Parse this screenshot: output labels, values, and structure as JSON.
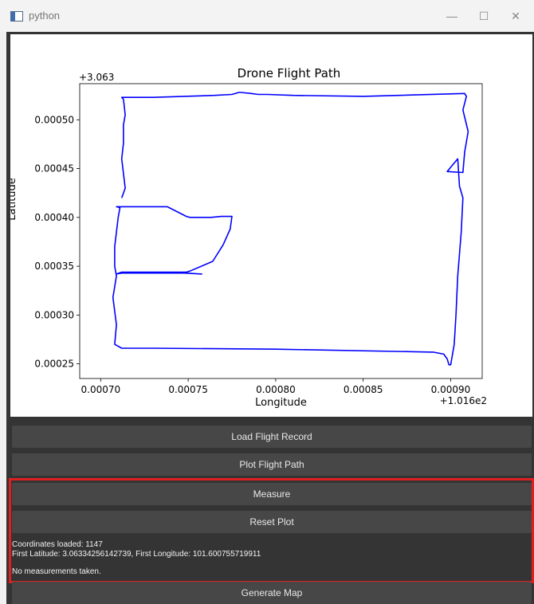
{
  "window": {
    "title": "python",
    "controls": [
      "—",
      "☐",
      "✕"
    ],
    "icon": "python-window-icon"
  },
  "chart_data": {
    "type": "line",
    "title": "Drone Flight Path",
    "xlabel": "Longitude",
    "ylabel": "Latitude",
    "x_offset_label": "+1.016e2",
    "y_offset_label": "+3.063",
    "xlim": [
      0.000688,
      0.000918
    ],
    "ylim": [
      0.000235,
      0.000537
    ],
    "x_ticks": [
      0.0007,
      0.00075,
      0.0008,
      0.00085,
      0.0009
    ],
    "x_tick_labels": [
      "0.00070",
      "0.00075",
      "0.00080",
      "0.00085",
      "0.00090"
    ],
    "y_ticks": [
      0.00025,
      0.0003,
      0.00035,
      0.0004,
      0.00045,
      0.0005
    ],
    "y_tick_labels": [
      "0.00025",
      "0.00030",
      "0.00035",
      "0.00040",
      "0.00045",
      "0.00050"
    ],
    "grid": false,
    "line_color": "#0000ff",
    "series": [
      {
        "x": [
          0.000758,
          0.000748,
          0.00072,
          0.000712,
          0.000709,
          0.000712,
          0.000749,
          0.000751,
          0.000764,
          0.00077,
          0.000774,
          0.000775,
          0.000769,
          0.000763,
          0.000757,
          0.000751,
          0.000749,
          0.000738,
          0.000712,
          0.000709,
          0.000711,
          0.00071,
          0.000708,
          0.000708,
          0.000709,
          0.000707,
          0.000709,
          0.000708,
          0.000712,
          0.00073,
          0.0008,
          0.00089,
          0.000896,
          0.000898,
          0.000899,
          0.0009,
          0.000902,
          0.000903,
          0.000904,
          0.000906,
          0.000907,
          0.000905,
          0.000904,
          0.000898,
          0.000907,
          0.000908,
          0.00091,
          0.000907,
          0.000909,
          0.000908,
          0.00085,
          0.00081,
          0.000795,
          0.00079,
          0.000786,
          0.00078,
          0.000779,
          0.000775,
          0.000765,
          0.00073,
          0.000712,
          0.000713,
          0.000714,
          0.000713,
          0.000713,
          0.000712,
          0.000714,
          0.000712
        ],
        "y": [
          0.000342,
          0.000343,
          0.000343,
          0.000343,
          0.000342,
          0.000344,
          0.000344,
          0.000345,
          0.000355,
          0.000372,
          0.000388,
          0.000401,
          0.000401,
          0.0004,
          0.0004,
          0.0004,
          0.000401,
          0.000411,
          0.000411,
          0.000411,
          0.00041,
          0.0004,
          0.00037,
          0.00035,
          0.00034,
          0.000318,
          0.00029,
          0.00027,
          0.000266,
          0.000266,
          0.000265,
          0.000262,
          0.00026,
          0.000255,
          0.000249,
          0.000249,
          0.00027,
          0.0003,
          0.00034,
          0.000385,
          0.00042,
          0.000432,
          0.00046,
          0.000447,
          0.000446,
          0.000467,
          0.000488,
          0.00051,
          0.000524,
          0.000527,
          0.000524,
          0.000525,
          0.000526,
          0.000526,
          0.000527,
          0.000528,
          0.000528,
          0.000526,
          0.000525,
          0.000523,
          0.000523,
          0.000521,
          0.000505,
          0.000495,
          0.000476,
          0.00046,
          0.00043,
          0.00042
        ]
      }
    ]
  },
  "buttons": {
    "load": "Load Flight Record",
    "plot": "Plot Flight Path",
    "measure": "Measure",
    "reset": "Reset Plot",
    "generate": "Generate Map"
  },
  "info": {
    "coords_loaded": "Coordinates loaded: 1147",
    "first_point": "First Latitude: 3.06334256142739, First Longitude: 101.600755719911",
    "measurements": "No measurements taken."
  },
  "colors": {
    "highlight": "#e01f1f",
    "panel_bg": "#343434",
    "button_bg": "#474747"
  }
}
